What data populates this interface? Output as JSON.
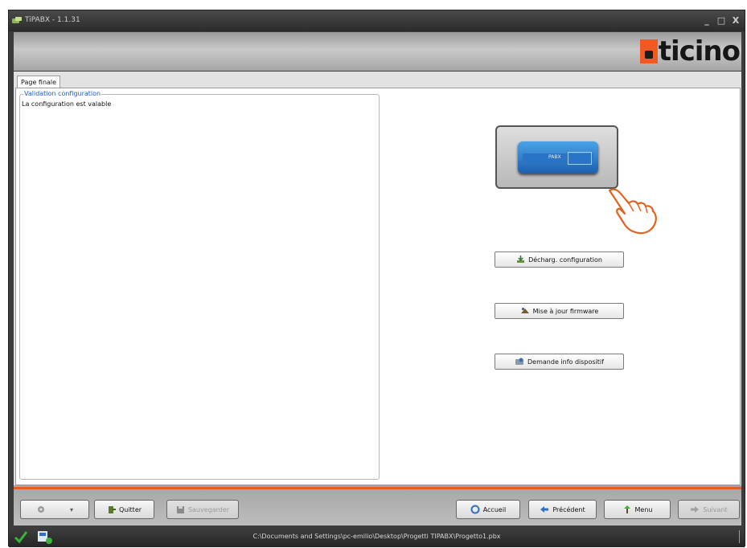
{
  "window": {
    "title": "TiPABX - 1.1.31",
    "controls": [
      "_",
      "□",
      "X"
    ]
  },
  "banner": {
    "logo_text": "ticino"
  },
  "tab": {
    "label": "Page finale"
  },
  "validation": {
    "group_label": "Validation configuration",
    "message": "La configuration est valable"
  },
  "device": {
    "label": "PABX"
  },
  "actions": {
    "download_config": "Décharg. configuration",
    "firmware_update": "Mise à jour firmware",
    "device_info": "Demande info dispositif"
  },
  "footer": {
    "quit": "Quitter",
    "save": "Sauvegarder",
    "home": "Accueil",
    "previous": "Précédent",
    "menu": "Menu",
    "next": "Suivant"
  },
  "status": {
    "file_path": "C:\\Documents and Settings\\pc-emilio\\Desktop\\Progetti TIPABX\\Progetto1.pbx"
  },
  "colors": {
    "accent_orange": "#e0621e",
    "link_blue": "#2060c8",
    "check_green": "#3cb43c"
  },
  "icons": {
    "download": "download-icon",
    "firmware": "firmware-icon",
    "info": "info-icon",
    "hand_pointer": "hand-pointer-icon"
  }
}
